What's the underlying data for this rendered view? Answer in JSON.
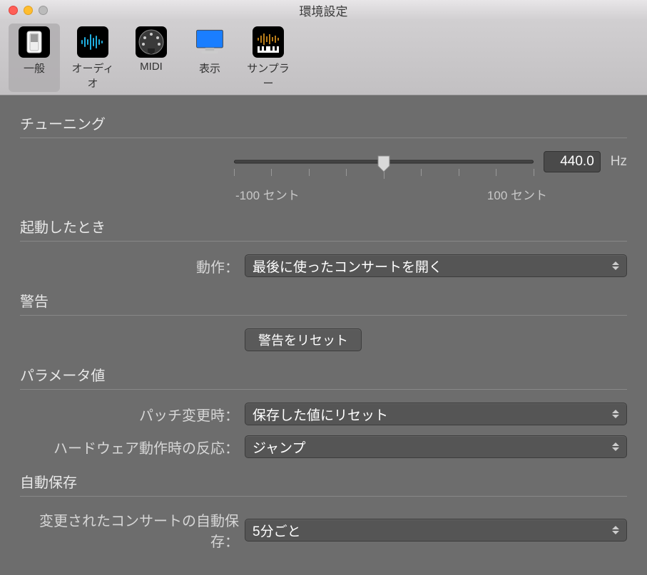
{
  "window": {
    "title": "環境設定"
  },
  "toolbar": {
    "general": "一般",
    "audio": "オーディオ",
    "midi": "MIDI",
    "display": "表示",
    "sampler": "サンプラー"
  },
  "sections": {
    "tuning": {
      "title": "チューニング",
      "min_label": "-100 セント",
      "max_label": "100 セント",
      "value": "440.0",
      "unit": "Hz",
      "slider_percent": 50
    },
    "startup": {
      "title": "起動したとき",
      "action_label": "動作：",
      "action_value": "最後に使ったコンサートを開く"
    },
    "alerts": {
      "title": "警告",
      "reset_label": "警告をリセット"
    },
    "params": {
      "title": "パラメータ値",
      "patch_label": "パッチ変更時：",
      "patch_value": "保存した値にリセット",
      "hw_label": "ハードウェア動作時の反応：",
      "hw_value": "ジャンプ"
    },
    "autosave": {
      "title": "自動保存",
      "label": "変更されたコンサートの自動保存：",
      "value": "5分ごと"
    }
  }
}
